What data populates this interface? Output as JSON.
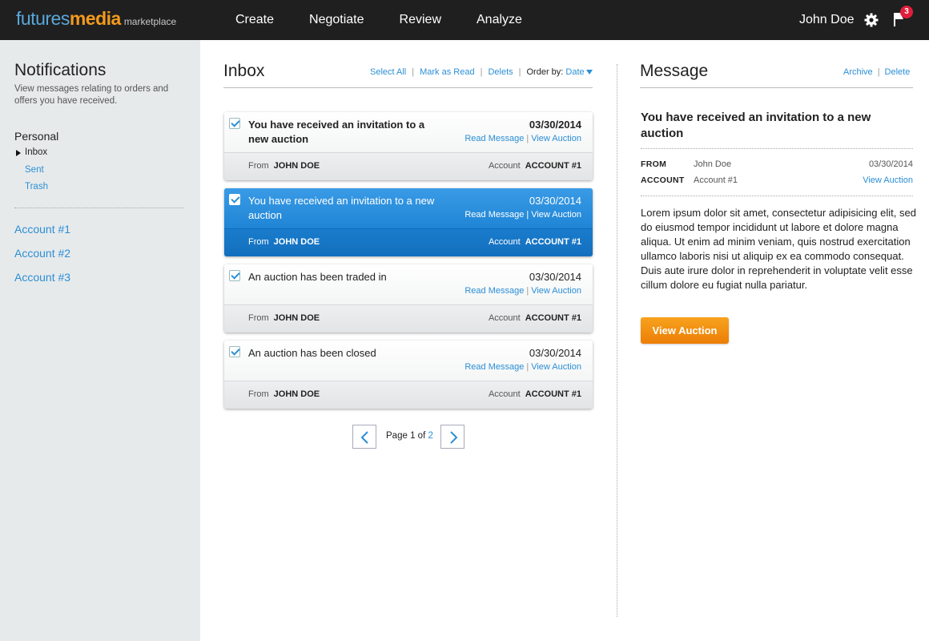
{
  "header": {
    "logo": {
      "part1": "futures",
      "part2": "media",
      "part3": "marketplace"
    },
    "nav": [
      "Create",
      "Negotiate",
      "Review",
      "Analyze"
    ],
    "user_name": "John Doe",
    "notification_count": "3",
    "icons": [
      "gear-icon",
      "flag-icon"
    ]
  },
  "sidebar": {
    "title": "Notifications",
    "description": "View messages relating to orders and offers you have received.",
    "personal_label": "Personal",
    "folders": [
      "Inbox",
      "Sent",
      "Trash"
    ],
    "accounts": [
      "Account #1",
      "Account #2",
      "Account #3"
    ]
  },
  "inbox": {
    "title": "Inbox",
    "actions": {
      "select_all": "Select All",
      "mark_read": "Mark as Read",
      "delete": "Delets",
      "order_label": "Order by:",
      "order_value": "Date"
    },
    "messages": [
      {
        "subject": "You have received an invitation to a new auction",
        "date": "03/30/2014",
        "read_link": "Read Message",
        "view_link": "View Auction",
        "from_label": "From",
        "from": "JOHN DOE",
        "account_label": "Account",
        "account": "ACCOUNT #1",
        "checked": true,
        "unread": true,
        "selected": false
      },
      {
        "subject": "You have received an invitation to a new auction",
        "date": "03/30/2014",
        "read_link": "Read Message",
        "view_link": "View Auction",
        "from_label": "From",
        "from": "JOHN DOE",
        "account_label": "Account",
        "account": "ACCOUNT #1",
        "checked": true,
        "unread": false,
        "selected": true
      },
      {
        "subject": "An auction has been traded in",
        "date": "03/30/2014",
        "read_link": "Read Message",
        "view_link": "View Auction",
        "from_label": "From",
        "from": "JOHN DOE",
        "account_label": "Account",
        "account": "ACCOUNT #1",
        "checked": true,
        "unread": false,
        "selected": false
      },
      {
        "subject": "An auction has been closed",
        "date": "03/30/2014",
        "read_link": "Read Message",
        "view_link": "View Auction",
        "from_label": "From",
        "from": "JOHN DOE",
        "account_label": "Account",
        "account": "ACCOUNT #1",
        "checked": true,
        "unread": false,
        "selected": false
      }
    ],
    "pager": {
      "prefix": "Page",
      "current": "1",
      "of": "of",
      "total": "2"
    }
  },
  "message": {
    "title": "Message",
    "archive": "Archive",
    "delete": "Delete",
    "subject": "You have received an invitation to a new auction",
    "from_label": "FROM",
    "from": "John Doe",
    "date": "03/30/2014",
    "account_label": "ACCOUNT",
    "account": "Account #1",
    "view_link": "View Auction",
    "body": "Lorem ipsum dolor sit amet, consectetur adipisicing elit, sed do eiusmod tempor incididunt ut labore et dolore magna aliqua. Ut enim ad minim veniam, quis nostrud exercitation ullamco laboris nisi ut aliquip ex ea commodo consequat. Duis aute irure dolor in reprehenderit in voluptate velit esse cillum dolore eu fugiat nulla pariatur.",
    "cta": "View Auction"
  },
  "colors": {
    "topbar": "#1f1f1f",
    "accent_blue": "#2b8fd6",
    "selected": "#1d83d4",
    "cta_orange": "#ec7e07",
    "badge_red": "#e01e3c"
  }
}
